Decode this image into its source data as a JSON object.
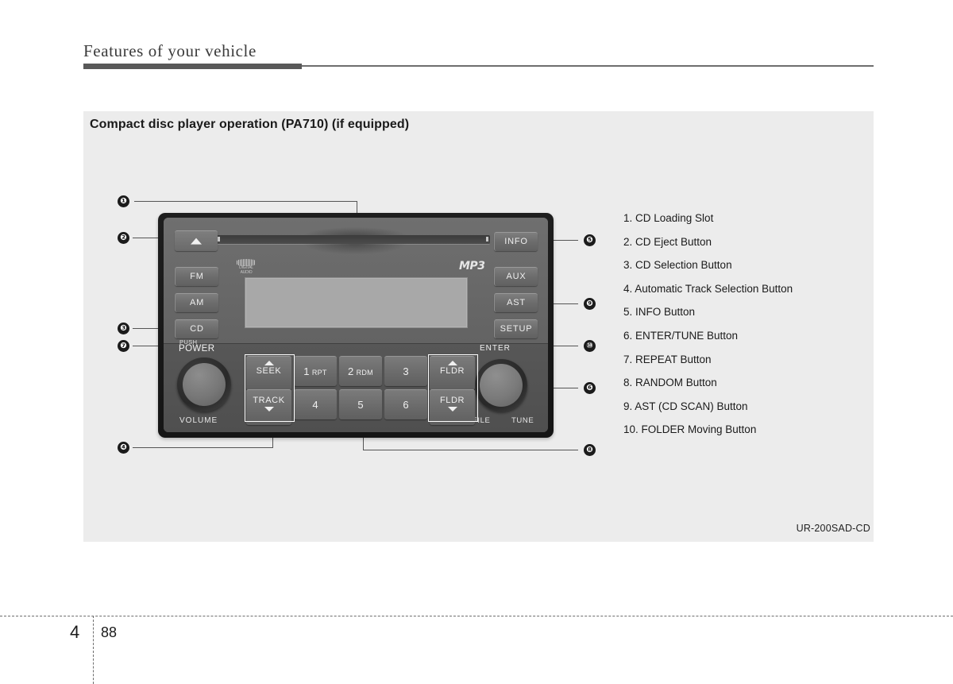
{
  "header": {
    "chapter_title": "Features of your vehicle"
  },
  "section": {
    "title": "Compact disc player operation (PA710) (if equipped)",
    "model_code": "UR-200SAD-CD"
  },
  "legend": {
    "items": [
      "1. CD Loading Slot",
      "2. CD Eject Button",
      "3. CD Selection Button",
      "4. Automatic Track Selection Button",
      "5. INFO Button",
      "6. ENTER/TUNE Button",
      "7. REPEAT Button",
      "8. RANDOM Button",
      "9. AST (CD SCAN) Button",
      "10. FOLDER Moving Button"
    ]
  },
  "callouts": {
    "c1": "❶",
    "c2": "❷",
    "c3": "❸",
    "c4": "❹",
    "c5": "❺",
    "c6": "❻",
    "c7": "❼",
    "c8": "❽",
    "c9": "❾",
    "c10": "⑩"
  },
  "head_unit": {
    "eject_icon": "eject-triangle",
    "left_buttons": [
      {
        "label": "FM"
      },
      {
        "label": "AM"
      },
      {
        "label": "CD"
      }
    ],
    "right_buttons": [
      {
        "label": "INFO"
      },
      {
        "label": "AUX"
      },
      {
        "label": "AST"
      },
      {
        "label": "SETUP"
      }
    ],
    "cd_logo": {
      "text_top": "COMPACT",
      "text_bottom": "DIGITAL AUDIO"
    },
    "mp3_logo": "MP3",
    "power_knob": {
      "push_label": "PUSH",
      "power_label": "POWER",
      "volume_label": "VOLUME"
    },
    "enter_knob": {
      "enter_label": "ENTER",
      "file_label": "FILE",
      "tune_label": "TUNE"
    },
    "seek_button": {
      "label": "SEEK",
      "direction": "up"
    },
    "track_button": {
      "label": "TRACK",
      "direction": "down"
    },
    "fldr_up_button": {
      "label": "FLDR",
      "direction": "up"
    },
    "fldr_down_button": {
      "label": "FLDR",
      "direction": "down"
    },
    "preset_buttons": [
      {
        "number": "1",
        "sub": "RPT"
      },
      {
        "number": "2",
        "sub": "RDM"
      },
      {
        "number": "3",
        "sub": ""
      },
      {
        "number": "4",
        "sub": ""
      },
      {
        "number": "5",
        "sub": ""
      },
      {
        "number": "6",
        "sub": ""
      }
    ]
  },
  "footer": {
    "chapter": "4",
    "page": "88"
  },
  "colors": {
    "panel_bg": "#ececec",
    "rule": "#595959",
    "text": "#1a1a1a",
    "unit_face": "#636363",
    "lcd": "#a8a8a8"
  }
}
